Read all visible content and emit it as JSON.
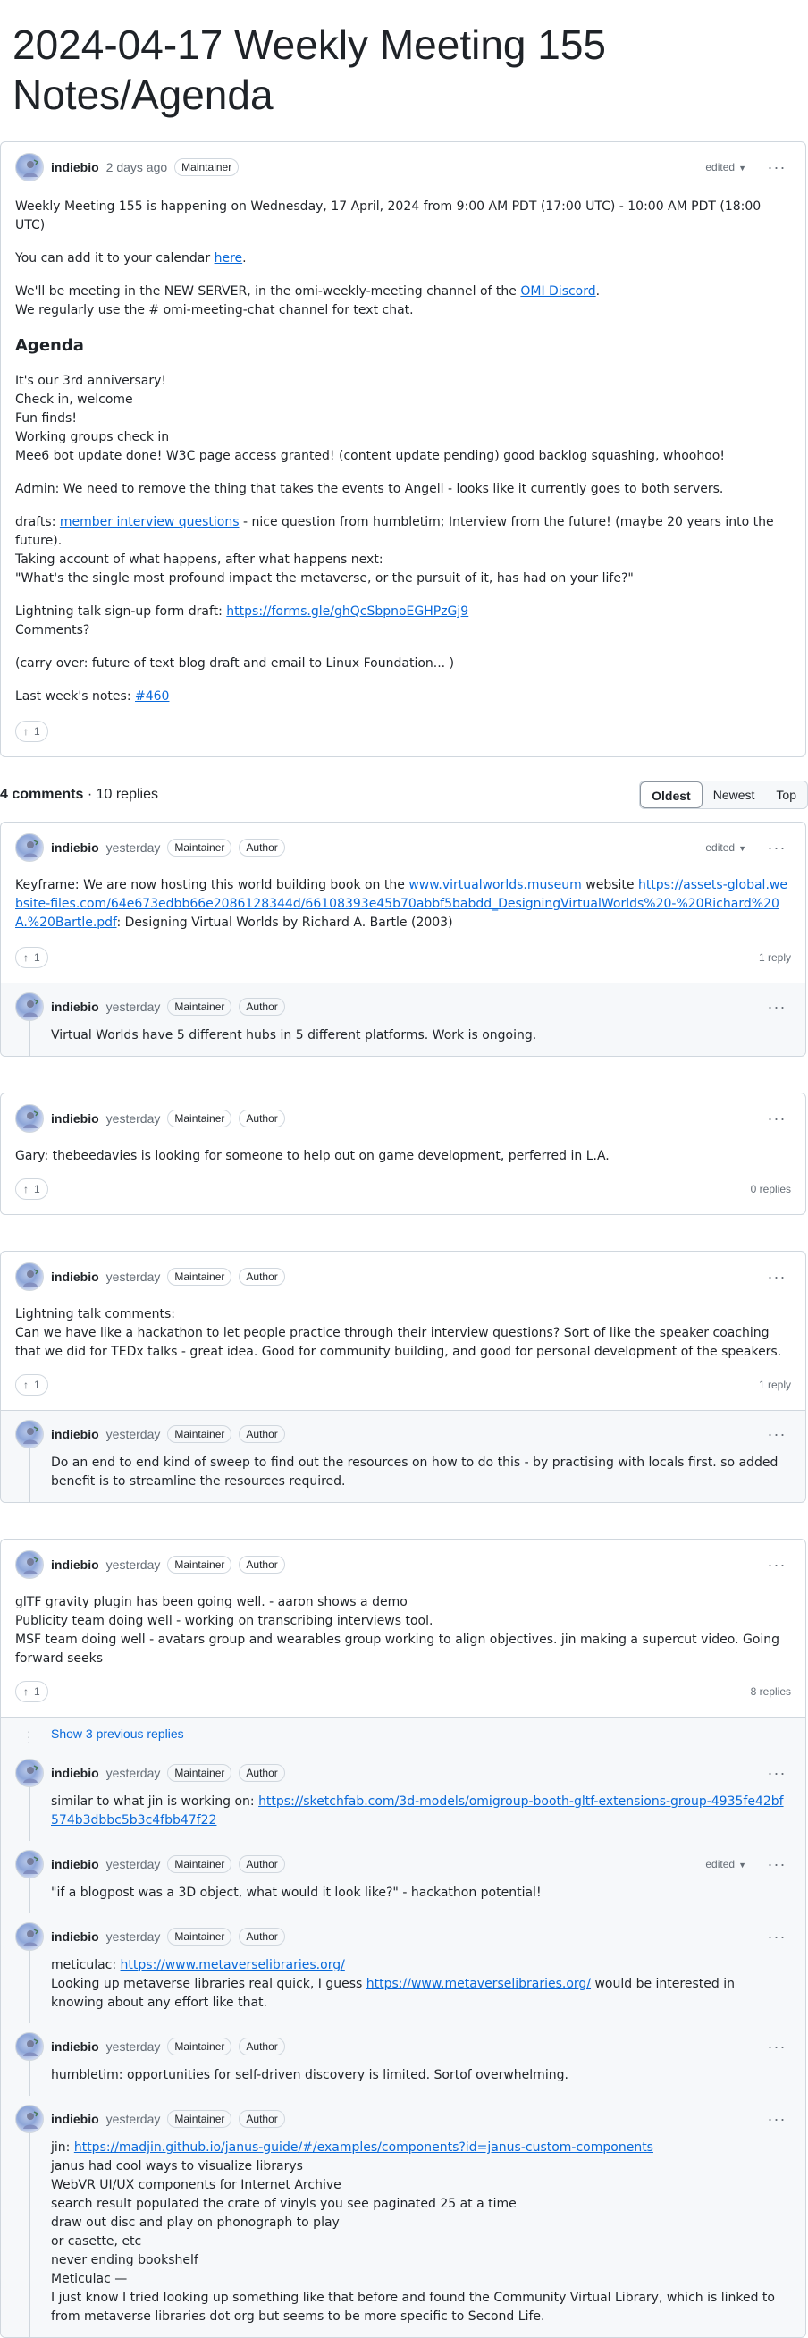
{
  "page": {
    "title": "2024-04-17 Weekly Meeting 155 Notes/Agenda"
  },
  "post": {
    "author": "indiebio",
    "time": "2 days ago",
    "badges": [
      "Maintainer"
    ],
    "edited": "edited",
    "p1": "Weekly Meeting 155 is happening on Wednesday, 17 April, 2024 from 9:00 AM PDT (17:00 UTC) - 10:00 AM PDT (18:00 UTC)",
    "p2_pre": "You can add it to your calendar ",
    "p2_link": "here",
    "p2_post": ".",
    "p3_pre": "We'll be meeting in the NEW SERVER, in the omi-weekly-meeting channel of the ",
    "p3_link": "OMI Discord",
    "p3_post": ".",
    "p3_line2": "We regularly use the # omi-meeting-chat channel for text chat.",
    "agenda_heading": "Agenda",
    "agenda": [
      "It's our 3rd anniversary!",
      "Check in, welcome",
      "Fun finds!",
      "Working groups check in",
      "Mee6 bot update done! W3C page access granted! (content update pending) good backlog squashing, whoohoo!"
    ],
    "admin": "Admin: We need to remove the thing that takes the events to Angell - looks like it currently goes to both servers.",
    "drafts_pre": "drafts: ",
    "drafts_link": "member interview questions",
    "drafts_post": " - nice question from humbletim; Interview from the future! (maybe 20 years into the future).",
    "drafts_line2": "Taking account of what happens, after what happens next:",
    "drafts_line3": "\"What's the single most profound impact the metaverse, or the pursuit of it, has had on your life?\"",
    "lightning_pre": "Lightning talk sign-up form draft: ",
    "lightning_link": "https://forms.gle/ghQcSbpnoEGHPzGj9",
    "lightning_line2": "Comments?",
    "carry": "(carry over: future of text blog draft and email to Linux Foundation... )",
    "last_pre": "Last week's notes: ",
    "last_link": "#460",
    "upvotes": "1"
  },
  "comments_header": {
    "count": "4 comments",
    "replies": " · 10 replies",
    "sort": [
      "Oldest",
      "Newest",
      "Top"
    ]
  },
  "comments": [
    {
      "author": "indiebio",
      "time": "yesterday",
      "badges": [
        "Maintainer",
        "Author"
      ],
      "edited": "edited",
      "pre": "Keyframe: We are now hosting this world building book on the ",
      "link1": "www.virtualworlds.museum",
      "mid": " website ",
      "link2": "https://assets-global.website-files.com/64e673edbb66e2086128344d/66108393e45b70abbf5babdd_DesigningVirtualWorlds%20-%20Richard%20A.%20Bartle.pdf",
      "post": ": Designing Virtual Worlds by Richard A. Bartle (2003)",
      "upvotes": "1",
      "reply_count": "1 reply",
      "replies": [
        {
          "author": "indiebio",
          "time": "yesterday",
          "badges": [
            "Maintainer",
            "Author"
          ],
          "text": "Virtual Worlds have 5 different hubs in 5 different platforms. Work is ongoing."
        }
      ]
    },
    {
      "author": "indiebio",
      "time": "yesterday",
      "badges": [
        "Maintainer",
        "Author"
      ],
      "text": "Gary: thebeedavies is looking for someone to help out on game development, perferred in L.A.",
      "upvotes": "1",
      "reply_count": "0 replies"
    },
    {
      "author": "indiebio",
      "time": "yesterday",
      "badges": [
        "Maintainer",
        "Author"
      ],
      "line1": "Lightning talk comments:",
      "line2": "Can we have like a hackathon to let people practice through their interview questions? Sort of like the speaker coaching that we did for TEDx talks - great idea. Good for community building, and good for personal development of the speakers.",
      "upvotes": "1",
      "reply_count": "1 reply",
      "replies": [
        {
          "author": "indiebio",
          "time": "yesterday",
          "badges": [
            "Maintainer",
            "Author"
          ],
          "text": "Do an end to end kind of sweep to find out the resources on how to do this - by practising with locals first. so added benefit is to streamline the resources required."
        }
      ]
    },
    {
      "author": "indiebio",
      "time": "yesterday",
      "badges": [
        "Maintainer",
        "Author"
      ],
      "line1": "glTF gravity plugin has been going well. - aaron shows a demo",
      "line2": "Publicity team doing well - working on transcribing interviews tool.",
      "line3": "MSF team doing well - avatars group and wearables group working to align objectives. jin making a supercut video. Going forward seeks",
      "upvotes": "1",
      "reply_count": "8 replies",
      "show_previous": "Show 3 previous replies",
      "replies": [
        {
          "author": "indiebio",
          "time": "yesterday",
          "badges": [
            "Maintainer",
            "Author"
          ],
          "pre": "similar to what jin is working on: ",
          "link": "https://sketchfab.com/3d-models/omigroup-booth-gltf-extensions-group-4935fe42bf574b3dbbc5b3c4fbb47f22"
        },
        {
          "author": "indiebio",
          "time": "yesterday",
          "badges": [
            "Maintainer",
            "Author"
          ],
          "edited": "edited",
          "text": "\"if a blogpost was a 3D object, what would it look like?\" - hackathon potential!"
        },
        {
          "author": "indiebio",
          "time": "yesterday",
          "badges": [
            "Maintainer",
            "Author"
          ],
          "pre": "meticulac: ",
          "link": "https://www.metaverselibraries.org/",
          "line2_pre": "Looking up metaverse libraries real quick, I guess ",
          "line2_link": "https://www.metaverselibraries.org/",
          "line2_post": " would be interested in knowing about any effort like that."
        },
        {
          "author": "indiebio",
          "time": "yesterday",
          "badges": [
            "Maintainer",
            "Author"
          ],
          "text": "humbletim: opportunities for self-driven discovery is limited. Sortof overwhelming."
        },
        {
          "author": "indiebio",
          "time": "yesterday",
          "badges": [
            "Maintainer",
            "Author"
          ],
          "pre": "jin: ",
          "link": "https://madjin.github.io/janus-guide/#/examples/components?id=janus-custom-components",
          "lines": [
            "janus had cool ways to visualize librarys",
            "WebVR UI/UX components for Internet Archive",
            "search result populated the crate of vinyls you see paginated 25 at a time",
            "draw out disc and play on phonograph to play",
            "or casette, etc",
            "never ending bookshelf",
            "Meticulac —",
            "I just know I tried looking up something like that before and found the Community Virtual Library, which is linked to from metaverse libraries dot org but seems to be more specific to Second Life."
          ]
        }
      ]
    }
  ]
}
